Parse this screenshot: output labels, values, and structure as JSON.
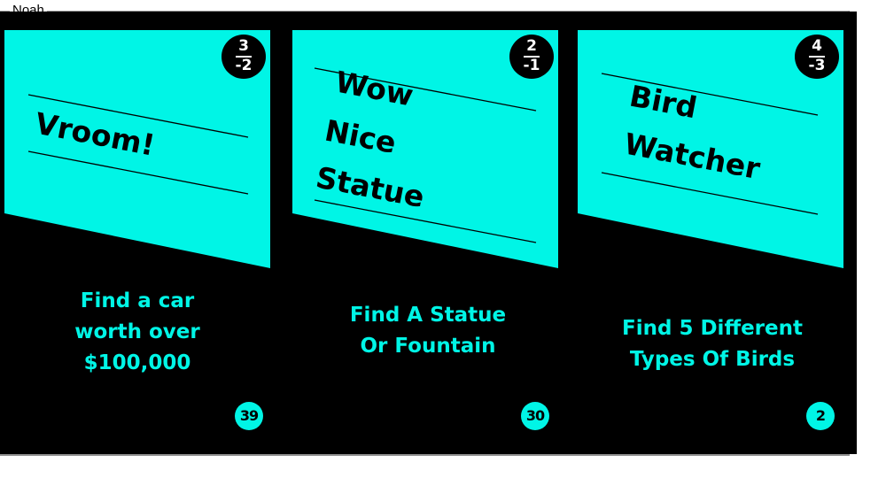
{
  "window": {
    "group_title": "Noah"
  },
  "colors": {
    "card_accent": "#00f5e6",
    "card_background": "#000000"
  },
  "cards": [
    {
      "title_lines": [
        "Vroom!"
      ],
      "cost_top": "3",
      "cost_bottom": "-2",
      "description_lines": [
        "Find a car",
        "worth over",
        "$100,000"
      ],
      "number": "39"
    },
    {
      "title_lines": [
        "Wow",
        "Nice",
        "Statue"
      ],
      "cost_top": "2",
      "cost_bottom": "-1",
      "description_lines": [
        "Find A Statue",
        "Or Fountain"
      ],
      "number": "30"
    },
    {
      "title_lines": [
        "Bird",
        "Watcher"
      ],
      "cost_top": "4",
      "cost_bottom": "-3",
      "description_lines": [
        "Find 5 Different",
        "Types Of Birds"
      ],
      "number": "2"
    }
  ]
}
